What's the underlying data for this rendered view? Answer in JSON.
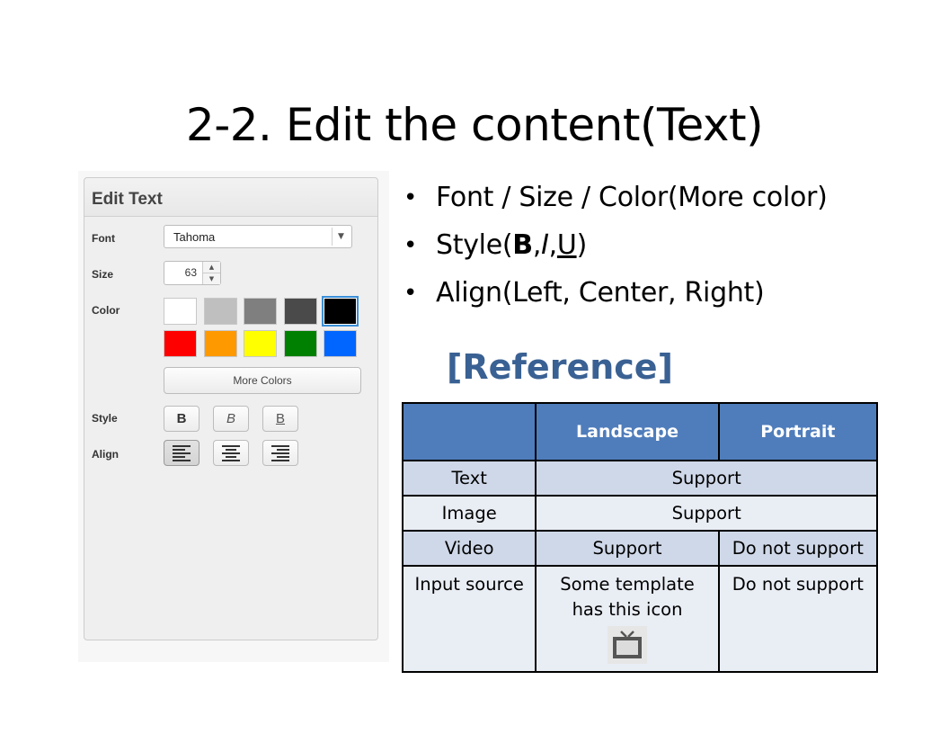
{
  "title": "2-2. Edit the content(Text)",
  "panel": {
    "header": "Edit Text",
    "font_label": "Font",
    "font_value": "Tahoma",
    "size_label": "Size",
    "size_value": "63",
    "color_label": "Color",
    "colors_row1": [
      "#ffffff",
      "#bfbfbf",
      "#7f7f7f",
      "#4a4a4a",
      "#000000"
    ],
    "colors_row2": [
      "#ff0000",
      "#ff9900",
      "#ffff00",
      "#008000",
      "#0066ff"
    ],
    "selected_color": "#000000",
    "more_colors": "More Colors",
    "style_label": "Style",
    "style_buttons": {
      "bold": "B",
      "italic": "B",
      "underline": "B"
    },
    "align_label": "Align",
    "active_align": "left"
  },
  "bullets": {
    "b1": "Font / Size / Color(More color)",
    "b2_prefix": "Style(",
    "b2_bold": "B",
    "b2_sep1": ",",
    "b2_italic": "I",
    "b2_sep2": ",",
    "b2_underline": "U",
    "b2_suffix": ")",
    "b3": "Align(Left, Center, Right)",
    "bullet_char": "•"
  },
  "reference_heading": "[Reference]",
  "table": {
    "headers": [
      "",
      "Landscape",
      "Portrait"
    ],
    "row_text": {
      "label": "Text",
      "value": "Support"
    },
    "row_image": {
      "label": "Image",
      "value": "Support"
    },
    "row_video": {
      "label": "Video",
      "landscape": "Support",
      "portrait": "Do not support"
    },
    "row_input": {
      "label": "Input source",
      "landscape_line1": "Some template",
      "landscape_line2": "has this icon",
      "portrait": "Do not support",
      "icon": "tv-icon"
    }
  }
}
